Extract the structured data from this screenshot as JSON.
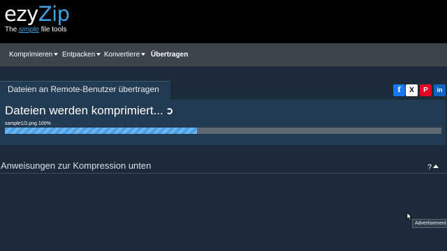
{
  "logo": {
    "ezy": "ezy",
    "zip": "Zip",
    "tagline_prefix": "The ",
    "tagline_simple": "simple",
    "tagline_suffix": " file tools"
  },
  "nav": {
    "items": [
      {
        "label": "Komprimieren",
        "dropdown": true
      },
      {
        "label": "Entpacken",
        "dropdown": true
      },
      {
        "label": "Konvertiere",
        "dropdown": true
      },
      {
        "label": "Übertragen",
        "dropdown": false,
        "active": true
      }
    ]
  },
  "panel": {
    "tab_label": "Dateien an Remote-Benutzer übertragen",
    "status_title": "Dateien werden komprimiert...",
    "file_progress_label": "sample1/2.png 100%",
    "progress_fraction": 0.44
  },
  "social": {
    "facebook": "f",
    "x": "X",
    "pinterest": "P",
    "linkedin": "in"
  },
  "instructions": {
    "title": "Anweisungen zur Kompression unten",
    "toggle": "?"
  },
  "ad": {
    "label": "Advertisement"
  },
  "colors": {
    "accent": "#3aa4e8",
    "navbar": "#3c444c",
    "panel": "#223a52",
    "background": "#1b2b3a"
  }
}
